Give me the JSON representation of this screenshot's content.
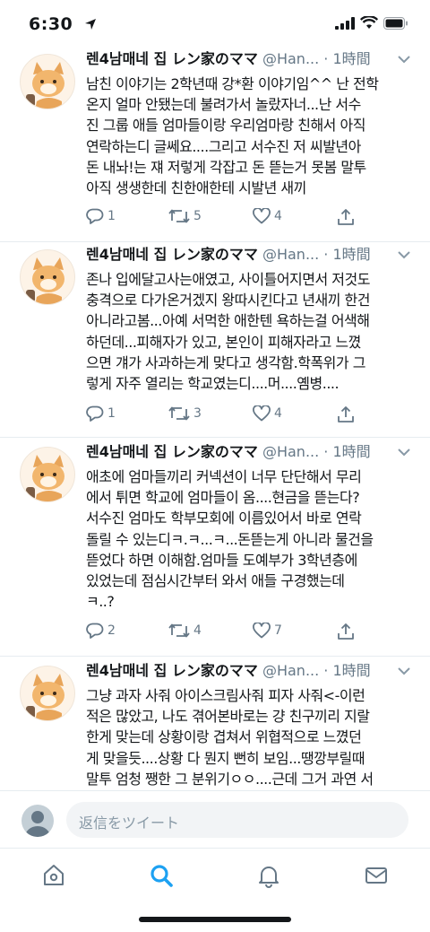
{
  "status_bar": {
    "time": "6:30"
  },
  "tweets": [
    {
      "display_name": "렌4남매네 집 レン家のママ",
      "handle": "@Han...",
      "separator": "·",
      "time": "1時間",
      "text": "남친 이야기는 2학년때 강*환 이야기임^^ 난 전학\n온지 얼마 안됐는데 불려가서 놀랐자너...난 서수\n진 그룹 애들 엄마들이랑 우리엄마랑 친해서 아직\n연락하는디 글쎄요....그리고 서수진 저 씨발년아\n돈 내놔!는 쟤 저렇게 각잡고 돈 뜯는거 못봄 말투\n아직 생생한데 친한애한테 시발년 새끼",
      "replies": "1",
      "retweets": "5",
      "likes": "4"
    },
    {
      "display_name": "렌4남매네 집 レン家のママ",
      "handle": "@Han...",
      "separator": "·",
      "time": "1時間",
      "text": "존나 입에달고사는애였고, 사이틀어지면서 저것도\n충격으로 다가온거겠지 왕따시킨다고 년새끼 한건\n아니라고봄...아예 서먹한 애한텐 욕하는걸 어색해\n하던데...피해자가 있고, 본인이 피해자라고 느꼈\n으면 걔가 사과하는게 맞다고 생각함.학폭위가 그\n렇게 자주 열리는 학교였는디....머....옘병....",
      "replies": "1",
      "retweets": "3",
      "likes": "4"
    },
    {
      "display_name": "렌4남매네 집 レン家のママ",
      "handle": "@Han...",
      "separator": "·",
      "time": "1時間",
      "text": "애초에 엄마들끼리 커넥션이 너무 단단해서 무리\n에서 튀면 학교에 엄마들이 옴....현금을 뜯는다?\n서수진 엄마도 학부모회에 이름있어서 바로 연락\n돌릴 수 있는디ㅋ.ㅋ...ㅋ...돈뜯는게 아니라 물건을\n뜯었다 하면 이해함.엄마들 도예부가 3학년층에\n있었는데 점심시간부터 와서 애들 구경했는데\nㅋ..?",
      "replies": "2",
      "retweets": "4",
      "likes": "7"
    },
    {
      "display_name": "렌4남매네 집 レン家のママ",
      "handle": "@Han...",
      "separator": "·",
      "time": "1時間",
      "text": "그냥 과자 사줘 아이스크림사줘 피자 사줘<-이런\n적은 많았고, 나도 겪어본바로는 걍 친구끼리 지랄\n한게 맞는데 상황이랑 겹쳐서 위협적으로 느꼈던\n게 맞을듯....상황 다 뭔지 뻔히 보임...땡깡부릴때\n말투 엄청 쨍한 그 분위기ㅇㅇ....근데 그거 과연 서"
    }
  ],
  "reply_bar": {
    "placeholder": "返信をツイート"
  },
  "tab_bar": [
    "home-icon",
    "search-icon",
    "notifications-icon",
    "messages-icon"
  ],
  "colors": {
    "accent": "#1da1f2",
    "secondary_text": "#657786",
    "divider": "#e6ecf0"
  }
}
